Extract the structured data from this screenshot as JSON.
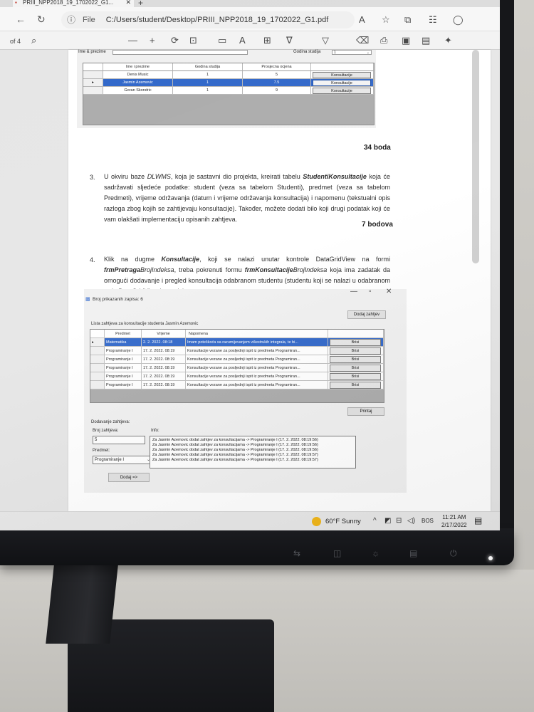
{
  "browser": {
    "tab_title": "PRIII_NPP2018_19_1702022_G1...",
    "file_label": "File",
    "url": "C:/Users/student/Desktop/PRIII_NPP2018_19_1702022_G1.pdf"
  },
  "pdf_toolbar": {
    "page_of": "of 4",
    "minus": "—",
    "plus": "+"
  },
  "form_top": {
    "name_label": "Ime & prezime",
    "year_label": "Godina studija",
    "year_value": "1",
    "columns": [
      "Ime i prezime",
      "Godina studija",
      "Prosjecna ocjena",
      ""
    ],
    "rows": [
      {
        "name": "Denis Music",
        "year": "1",
        "avg": "5",
        "action": "Konsultacije"
      },
      {
        "name": "Jasmin Azemovic",
        "year": "1",
        "avg": "7.5",
        "action": "Konsultacije"
      },
      {
        "name": "Goran Skondric",
        "year": "1",
        "avg": "9",
        "action": "Konsultacije"
      }
    ]
  },
  "doc": {
    "points_34": "34 boda",
    "item3_num": "3.",
    "item3_pre": "U okviru baze ",
    "item3_db": "DLWMS",
    "item3_mid": ", koja je sastavni dio projekta, kreirati tabelu ",
    "item3_table": "StudentiKonsultacije",
    "item3_rest": " koja će sadržavati sljedeće podatke: student (veza sa tabelom Studenti), predmet (veza sa tabelom Predmeti), vrijeme održavanja (datum i vrijeme održavanja konsultacija) i napomenu (tekstualni opis razloga zbog kojih se zahtijevaju konsultacije). Također, možete dodati bilo koji drugi podatak koji će vam olakšati implementaciju opisanih zahtjeva.",
    "points_7": "7 bodova",
    "item4_num": "4.",
    "item4_a": "Klik na dugme ",
    "item4_btn": "Konsultacije",
    "item4_b": ", koji se nalazi unutar kontrole DataGridView na formi ",
    "item4_form1": "frmPretraga",
    "item4_form1_i": "BrojIndeksa",
    "item4_c": ", treba pokrenuti formu ",
    "item4_form2": "frmKonsultacije",
    "item4_form2_i": "BrojIndeksa",
    "item4_d": " koja ima zadatak da omogući dodavanje i pregled konsultacija odabranom studentu (studentu koji se nalazi u odabranom redu DataGridView kontrole)."
  },
  "form2": {
    "window_title": "Broj prikazanih zapisa: 6",
    "add_request_button": "Dodaj zahtjev",
    "list_title": "Lista zahtjeva za konsultacije studenta Jasmin Azemovic",
    "columns": [
      "Predmet",
      "Vrijeme",
      "Napomena",
      ""
    ],
    "rows": [
      {
        "subject": "Matematika",
        "time": "2. 2. 2022. 08:18",
        "note": "Imam poteškoća sa razumijevanjem višestrukih integrala, te bi...",
        "action": "Brisi"
      },
      {
        "subject": "Programiranje I",
        "time": "17. 2. 2022. 08:19",
        "note": "Konsultacije vezane za posljednji ispit iz predmeta Programiran...",
        "action": "Brisi"
      },
      {
        "subject": "Programiranje I",
        "time": "17. 2. 2022. 08:19",
        "note": "Konsultacije vezane za posljednji ispit iz predmeta Programiran...",
        "action": "Brisi"
      },
      {
        "subject": "Programiranje I",
        "time": "17. 2. 2022. 08:19",
        "note": "Konsultacije vezane za posljednji ispit iz predmeta Programiran...",
        "action": "Brisi"
      },
      {
        "subject": "Programiranje I",
        "time": "17. 2. 2022. 08:19",
        "note": "Konsultacije vezane za posljednji ispit iz predmeta Programiran...",
        "action": "Brisi"
      },
      {
        "subject": "Programiranje I",
        "time": "17. 2. 2022. 08:19",
        "note": "Konsultacije vezane za posljednji ispit iz predmeta Programiran...",
        "action": "Brisi"
      }
    ],
    "print_button": "Printaj",
    "adding_label": "Dodavanje zahtjeva:",
    "count_label": "Broj zahtjeva:",
    "count_value": "5",
    "subject_label": "Predmet:",
    "subject_value": "Programiranje I",
    "info_label": "Info:",
    "info_lines": [
      "Za Jasmin Azemovic dodat zahtjev za konsultacijama -> Programiranje I (17. 2. 2022. 08:19:56)",
      "Za Jasmin Azemovic dodat zahtjev za konsultacijama -> Programiranje I (17. 2. 2022. 08:19:56)",
      "Za Jasmin Azemovic dodat zahtjev za konsultacijama -> Programiranje I (17. 2. 2022. 08:19:56)",
      "Za Jasmin Azemovic dodat zahtjev za konsultacijama -> Programiranje I (17. 2. 2022. 08:19:57)",
      "Za Jasmin Azemovic dodat zahtjev za konsultacijama -> Programiranje I (17. 2. 2022. 08:19:57)"
    ],
    "add_button": "Dodaj =>"
  },
  "taskbar": {
    "weather": "60°F  Sunny",
    "language": "BOS",
    "time": "11:21 AM",
    "date": "2/17/2022"
  },
  "colors": {
    "selection_blue": "#2f66c9",
    "weather_sun": "#f2b618"
  }
}
